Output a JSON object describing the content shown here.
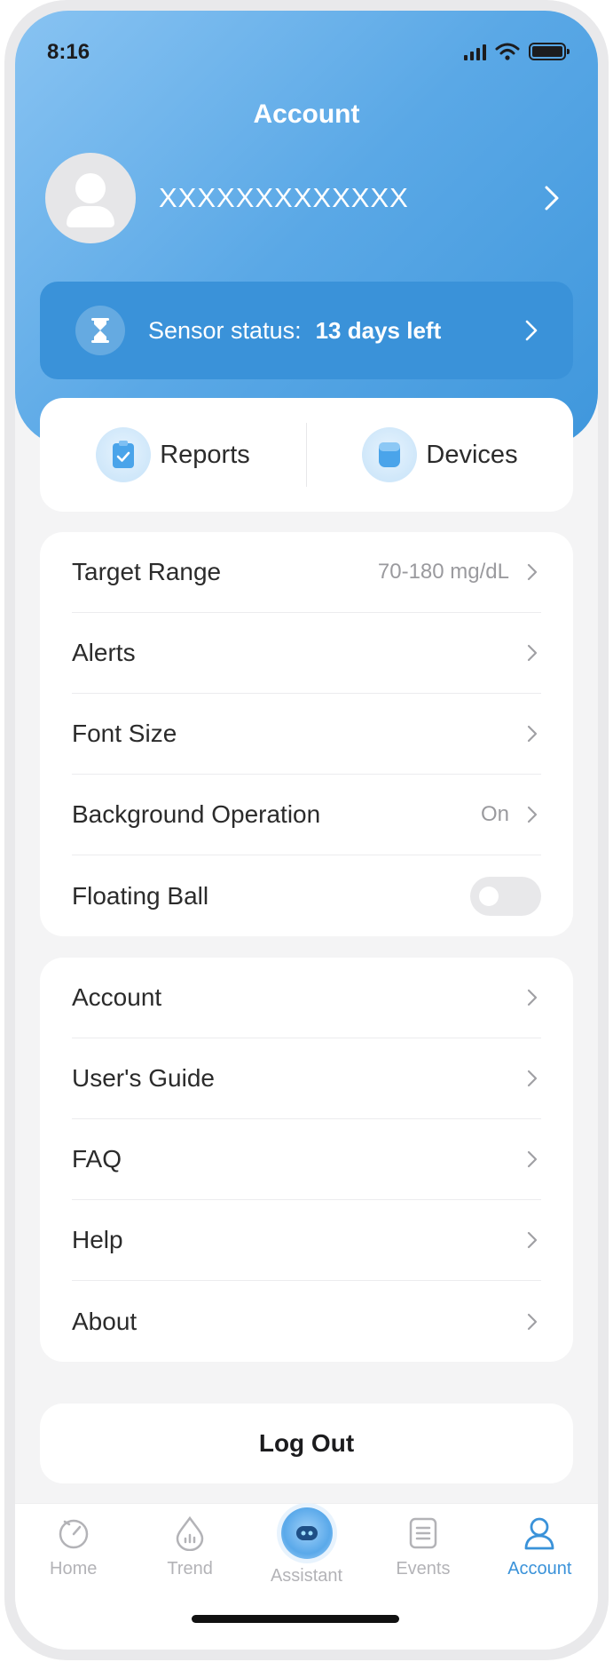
{
  "status_bar": {
    "time": "8:16"
  },
  "header": {
    "title": "Account"
  },
  "profile": {
    "name": "XXXXXXXXXXXXX"
  },
  "sensor": {
    "label": "Sensor status:",
    "value": "13 days left"
  },
  "quick_actions": [
    {
      "label": "Reports",
      "icon": "clipboard-check-icon"
    },
    {
      "label": "Devices",
      "icon": "sensor-device-icon"
    }
  ],
  "settings": {
    "target_range": {
      "label": "Target Range",
      "value": "70-180 mg/dL"
    },
    "alerts": {
      "label": "Alerts"
    },
    "font_size": {
      "label": "Font Size"
    },
    "background_operation": {
      "label": "Background Operation",
      "value": "On"
    },
    "floating_ball": {
      "label": "Floating Ball",
      "enabled": false
    }
  },
  "menu": {
    "account": "Account",
    "users_guide": "User's Guide",
    "faq": "FAQ",
    "help": "Help",
    "about": "About"
  },
  "logout": {
    "label": "Log Out"
  },
  "tabbar": {
    "tabs": [
      {
        "label": "Home",
        "icon": "home-gauge-icon"
      },
      {
        "label": "Trend",
        "icon": "trend-drop-icon"
      },
      {
        "label": "Assistant",
        "icon": "assistant-robot-icon"
      },
      {
        "label": "Events",
        "icon": "events-list-icon"
      },
      {
        "label": "Account",
        "icon": "account-person-icon"
      }
    ],
    "active": "Account"
  },
  "colors": {
    "accent": "#3a92d9",
    "hero_start": "#88c3f2",
    "hero_end": "#3f97dc"
  }
}
